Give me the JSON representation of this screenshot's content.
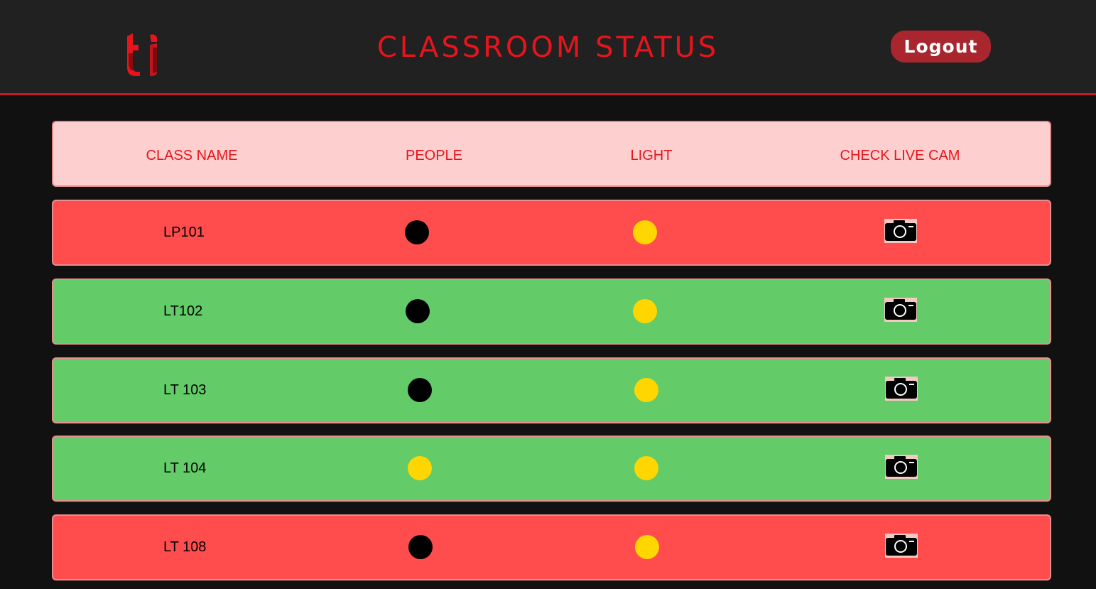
{
  "header": {
    "title": "CLASSROOM STATUS",
    "logout_label": "Logout",
    "logo_icon": "ti-logo-icon"
  },
  "colors": {
    "accent": "#e8141c",
    "occupied_red": "#ff4d4d",
    "available_green": "#63cc69",
    "indicator_off": "#000000",
    "indicator_on": "#ffd600",
    "header_row_bg": "#fdd0cf"
  },
  "table": {
    "columns": [
      "CLASS NAME",
      "PEOPLE",
      "LIGHT",
      "CHECK LIVE CAM"
    ],
    "rows": [
      {
        "class_name": "LP101",
        "status": "red",
        "people": "off",
        "light": "on",
        "cam_icon": "camera-icon"
      },
      {
        "class_name": "LT102",
        "status": "green",
        "people": "off",
        "light": "on",
        "cam_icon": "camera-icon"
      },
      {
        "class_name": "LT 103",
        "status": "green",
        "people": "off",
        "light": "on",
        "cam_icon": "camera-icon"
      },
      {
        "class_name": "LT 104",
        "status": "green",
        "people": "on",
        "light": "on",
        "cam_icon": "camera-icon"
      },
      {
        "class_name": "LT 108",
        "status": "red",
        "people": "off",
        "light": "on",
        "cam_icon": "camera-icon"
      }
    ]
  }
}
